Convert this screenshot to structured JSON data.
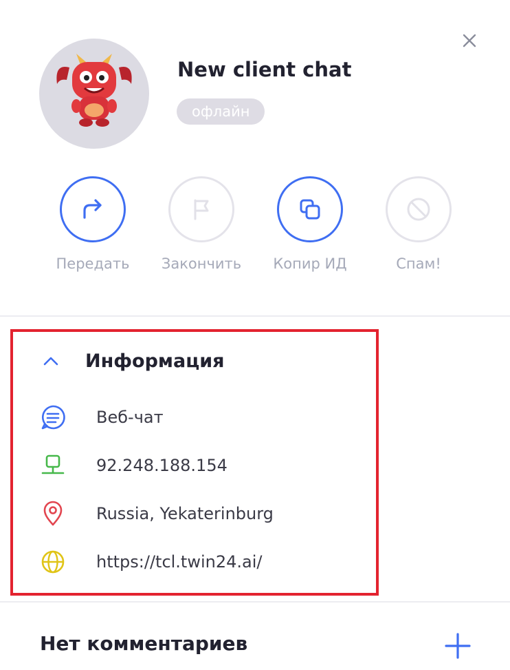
{
  "header": {
    "title": "New client chat",
    "status": "офлайн",
    "avatar_icon": "red-monster-mascot-icon",
    "close_icon": "close-icon"
  },
  "actions": [
    {
      "label": "Передать",
      "icon": "forward-arrow-icon",
      "enabled": true
    },
    {
      "label": "Закончить",
      "icon": "flag-icon",
      "enabled": false
    },
    {
      "label": "Копир ИД",
      "icon": "copy-icon",
      "enabled": true
    },
    {
      "label": "Спам!",
      "icon": "block-icon",
      "enabled": false
    }
  ],
  "info": {
    "title": "Информация",
    "expanded": true,
    "items": [
      {
        "icon": "chat-bubble-icon",
        "text": "Веб-чат"
      },
      {
        "icon": "network-icon",
        "text": "92.248.188.154"
      },
      {
        "icon": "location-pin-icon",
        "text": "Russia, Yekaterinburg"
      },
      {
        "icon": "globe-icon",
        "text": "https://tcl.twin24.ai/"
      }
    ]
  },
  "comments": {
    "title": "Нет комментариев",
    "add_icon": "plus-icon"
  },
  "colors": {
    "accent": "#3f6ef2",
    "disabled": "#e4e3ea",
    "highlight_border": "#e3232f",
    "network": "#46b84a",
    "location": "#e2454f",
    "globe": "#e0c417"
  }
}
